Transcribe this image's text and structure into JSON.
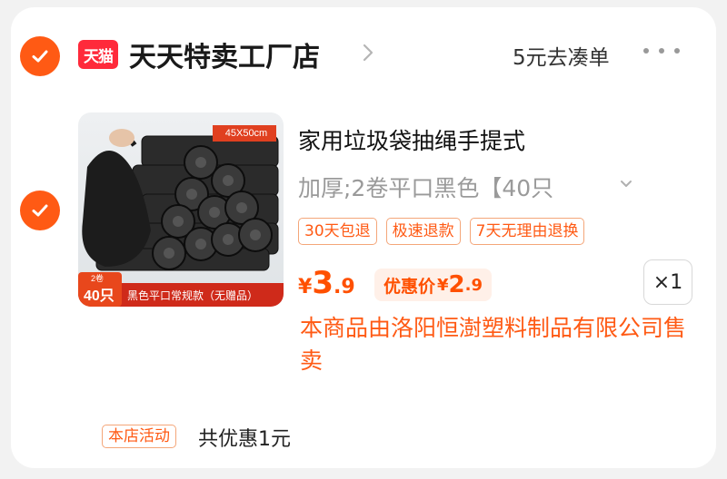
{
  "store": {
    "checked": true,
    "platform_logo": "天猫",
    "name": "天天特卖工厂店",
    "coudan_label": "5元去凑单",
    "icons": [
      "check-icon",
      "chevron-right-icon",
      "more-icon"
    ]
  },
  "item": {
    "checked": true,
    "image": {
      "size_label": "45X50cm",
      "count_small": "2卷",
      "count_big": "40只",
      "banner": "黑色平口常规款（无赠品）"
    },
    "title": "家用垃圾袋抽绳手提式",
    "sku": "加厚;2卷平口黑色【40只",
    "tags": [
      "30天包退",
      "极速退款",
      "7天无理由退换"
    ],
    "price": {
      "currency": "¥",
      "int": "3",
      "dec": ".9"
    },
    "discount": {
      "label": "优惠价",
      "currency": "¥",
      "int": "2",
      "dec": ".9"
    },
    "quantity": "×1",
    "seller_note": "本商品由洛阳恒澍塑料制品有限公司售卖"
  },
  "promo": {
    "tag": "本店活动",
    "text": "共优惠1元"
  },
  "colors": {
    "accent": "#ff5a14",
    "price": "#ff5000",
    "tmall_red": "#ff2a3b",
    "tag_border": "#f4a679"
  }
}
